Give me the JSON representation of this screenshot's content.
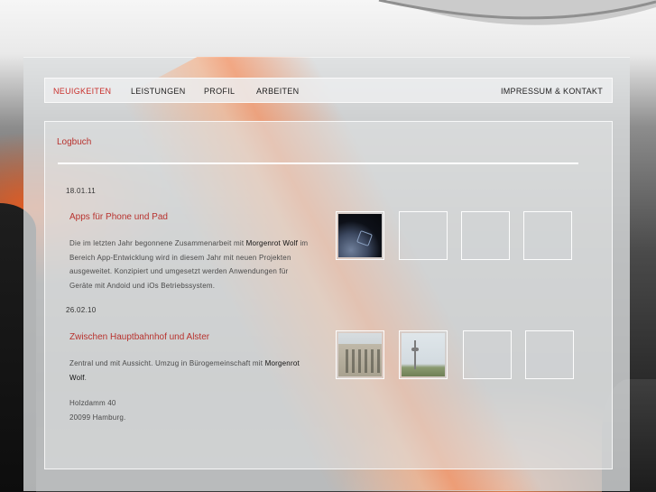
{
  "nav": {
    "items": [
      "NEUIGKEITEN",
      "LEISTUNGEN",
      "PROFIL",
      "ARBEITEN"
    ],
    "right": "IMPRESSUM & KONTAKT",
    "active_color": "#c9302c"
  },
  "section": {
    "heading": "Logbuch"
  },
  "posts": [
    {
      "date": "18.01.11",
      "title": "Apps für Phone und Pad",
      "text_before": "Die im letzten Jahr begonnene Zusammenarbeit mit ",
      "highlight": "Morgenrot Wolf",
      "text_after": " im Bereich App-Entwicklung wird in diesem Jahr mit neuen Projekten ausgeweitet. Konzipiert und umgesetzt werden Anwendungen für Geräte mit Andoid und iOs Betriebssystem."
    },
    {
      "date": "26.02.10",
      "title": "Zwischen Hauptbahnhof und Alster",
      "text_before": "Zentral und mit Aussicht. Umzug in Bürogemeinschaft mit ",
      "highlight": "Morgenrot Wolf",
      "text_after": ".",
      "address": [
        "Holzdamm 40",
        "20099 Hamburg."
      ]
    }
  ],
  "accent_color": "#b8322e"
}
